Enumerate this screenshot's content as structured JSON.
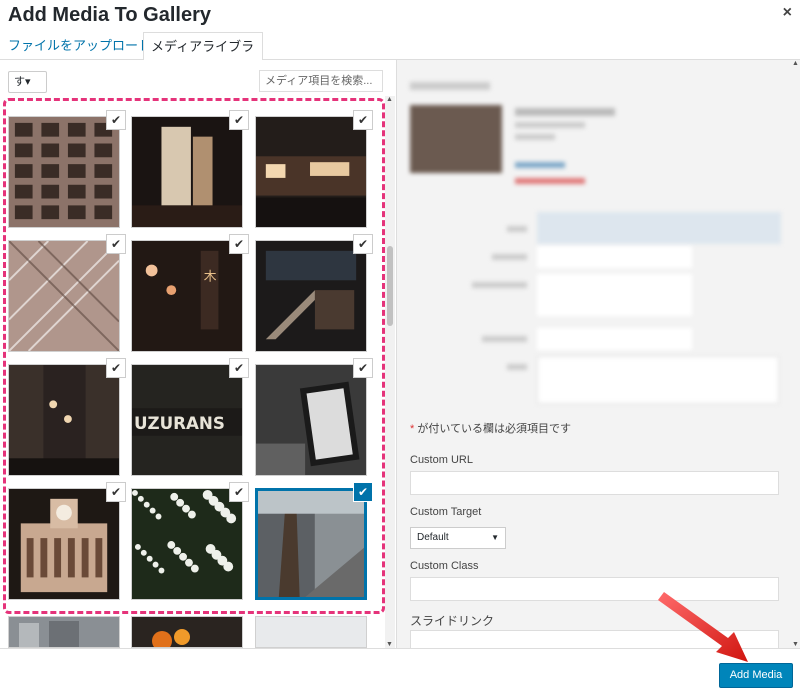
{
  "header": {
    "title": "Add Media To Gallery",
    "close_glyph": "×"
  },
  "tabs": [
    {
      "label": "ファイルをアップロード"
    },
    {
      "label": "メディアライブラリ"
    }
  ],
  "toolbar": {
    "filter_value": "す▾",
    "search_placeholder": "メディア項目を検索..."
  },
  "grid": {
    "check_glyph": "✔",
    "selected_index": 11,
    "thumbs": [
      {
        "name": "building-facade"
      },
      {
        "name": "night-tower"
      },
      {
        "name": "night-street"
      },
      {
        "name": "glass-atrium"
      },
      {
        "name": "neon-sign-street"
      },
      {
        "name": "stairway-night"
      },
      {
        "name": "alley-night"
      },
      {
        "name": "uzurans-sign"
      },
      {
        "name": "sign-monochrome"
      },
      {
        "name": "clock-tower"
      },
      {
        "name": "white-flowers"
      },
      {
        "name": "tree-walkway"
      }
    ]
  },
  "details": {
    "required_note": "* が付いている欄は必須項目です",
    "required_star": "*",
    "required_text": " が付いている欄は必須項目です",
    "custom_url_label": "Custom URL",
    "custom_target_label": "Custom Target",
    "custom_target_value": "Default",
    "custom_class_label": "Custom Class",
    "slide_link_label": "スライドリンク"
  },
  "footer": {
    "add_media_label": "Add Media"
  },
  "colors": {
    "accent": "#0073aa",
    "button": "#0085ba",
    "highlight": "#e5337a",
    "arrow": "#e0201b"
  }
}
